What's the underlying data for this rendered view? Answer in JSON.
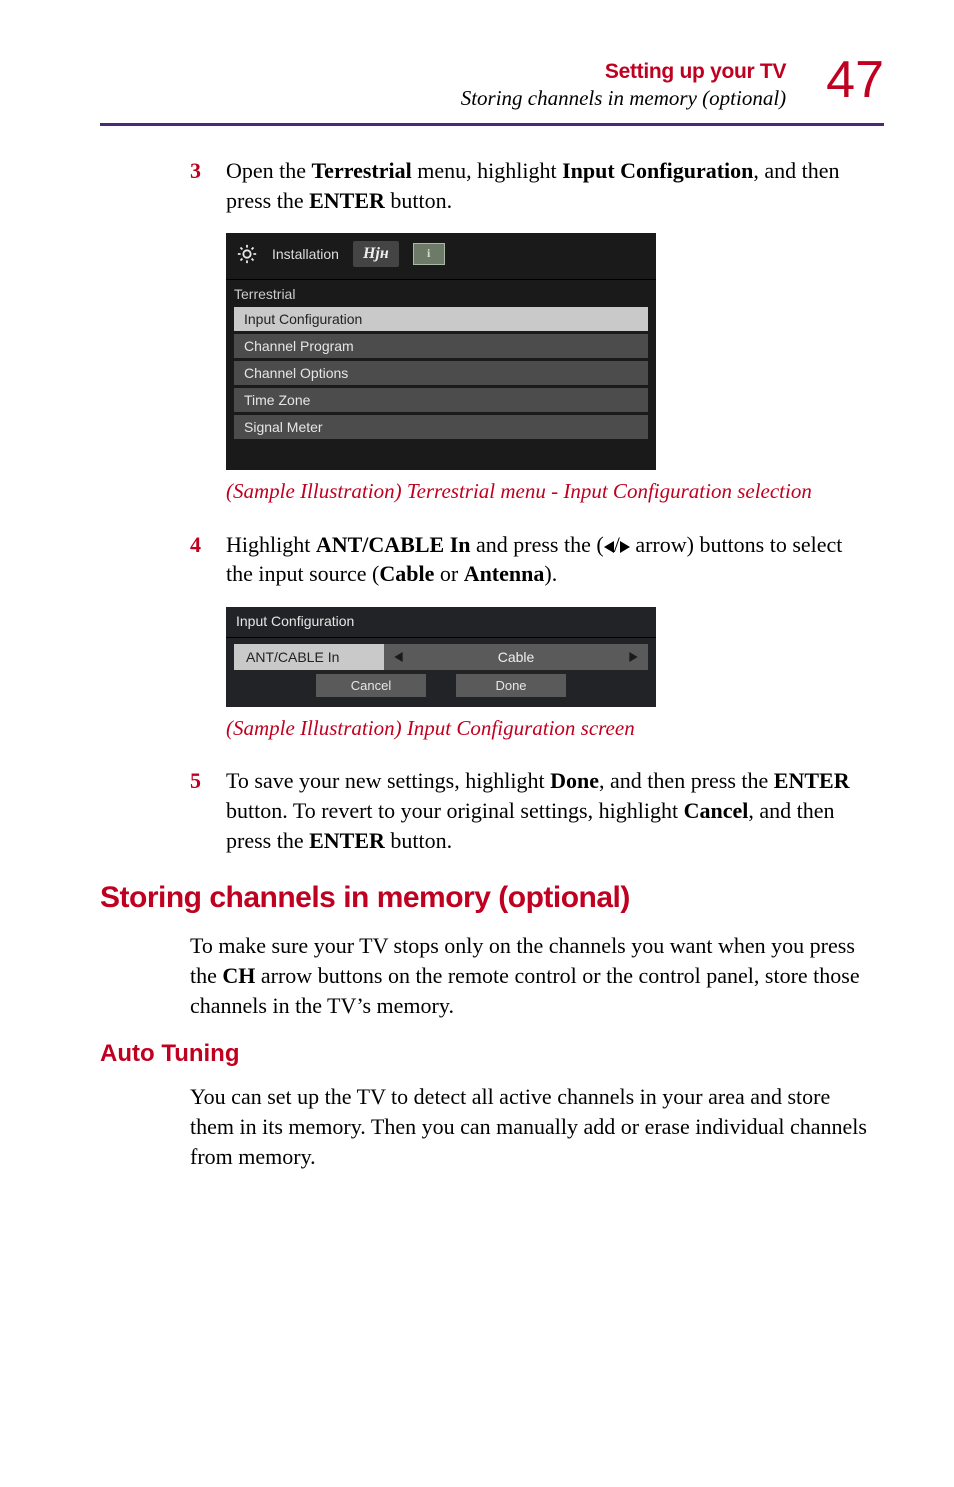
{
  "header": {
    "section_title": "Setting up your TV",
    "section_subtitle": "Storing channels in memory (optional)",
    "page_number": "47"
  },
  "steps": {
    "s3": {
      "num": "3",
      "pre": "Open the ",
      "b1": "Terrestrial",
      "mid1": " menu, highlight ",
      "b2": "Input Configuration",
      "mid2": ", and then press the ",
      "b3": "ENTER",
      "post": " button."
    },
    "s4": {
      "num": "4",
      "pre": "Highlight ",
      "b1": "ANT/CABLE In",
      "mid1": " and press the (",
      "arrow_sep": "/",
      "mid2": " arrow) buttons to select the input source (",
      "b2": "Cable",
      "or": " or ",
      "b3": "Antenna",
      "post": ")."
    },
    "s5": {
      "num": "5",
      "pre": "To save your new settings, highlight ",
      "b1": "Done",
      "mid1": ", and then press the ",
      "b2": "ENTER",
      "mid2": " button. To revert to your original settings, highlight ",
      "b3": "Cancel",
      "mid3": ", and then press the ",
      "b4": "ENTER",
      "post": " button."
    }
  },
  "shot1": {
    "tab_label": "Installation",
    "tab2_glyph": "HH",
    "section": "Terrestrial",
    "rows": [
      "Input Configuration",
      "Channel Program",
      "Channel Options",
      "Time Zone",
      "Signal Meter"
    ]
  },
  "caption1": "(Sample Illustration) Terrestrial menu - Input Configuration selection",
  "shot2": {
    "title": "Input Configuration",
    "row_label": "ANT/CABLE In",
    "row_value": "Cable",
    "btn_cancel": "Cancel",
    "btn_done": "Done"
  },
  "caption2": "(Sample Illustration) Input Configuration screen",
  "h1": "Storing channels in memory (optional)",
  "para1_pre": "To make sure your TV stops only on the channels you want when you press the ",
  "para1_b": "CH",
  "para1_post": " arrow buttons on the remote control or the control panel, store those channels in the TV’s memory.",
  "h2": "Auto Tuning",
  "para2": "You can set up the TV to detect all active channels in your area and store them in its memory. Then you can manually add or erase individual channels from memory."
}
